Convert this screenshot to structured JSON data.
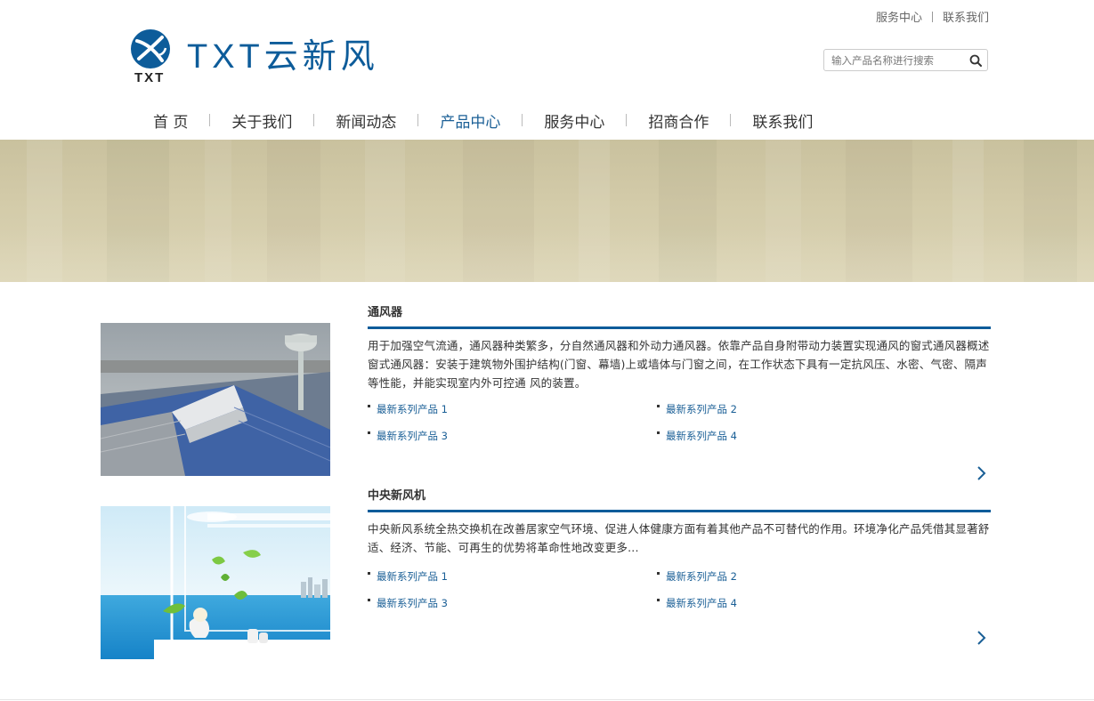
{
  "top_links": {
    "service": "服务中心",
    "contact": "联系我们"
  },
  "logo": {
    "mark_text": "TXT",
    "text": "TXT云新风",
    "brand_color": "#0d5c9a"
  },
  "search": {
    "placeholder": "输入产品名称进行搜索",
    "value": "",
    "icon": "search-icon"
  },
  "nav": {
    "items": [
      "首 页",
      "关于我们",
      "新闻动态",
      "产品中心",
      "服务中心",
      "招商合作",
      "联系我们"
    ],
    "active": "产品中心",
    "active_color": "#1a5f96"
  },
  "products": [
    {
      "title": "通风器",
      "description": "用于加强空气流通，通风器种类繁多，分自然通风器和外动力通风器。依靠产品自身附带动力装置实现通风的窗式通风器概述窗式通风器：安装于建筑物外围护结构(门窗、幕墙)上或墙体与门窗之间，在工作状态下具有一定抗风压、水密、气密、隔声等性能，并能实现室内外可控通 风的装置。",
      "links": [
        "最新系列产品 1",
        "最新系列产品 2",
        "最新系列产品 3",
        "最新系列产品 4"
      ],
      "image": "rooftop-ventilator-photo",
      "more_icon": "chevron-right-icon"
    },
    {
      "title": "中央新风机",
      "description": "中央新风系统全热交换机在改善居家空气环境、促进人体健康方面有着其他产品不可替代的作用。环境净化产品凭借其显著舒适、经济、节能、可再生的优势将革命性地改变更多...",
      "links": [
        "最新系列产品 1",
        "最新系列产品 2",
        "最新系列产品 3",
        "最新系列产品 4"
      ],
      "image": "fresh-air-seaside-photo",
      "more_icon": "chevron-right-icon"
    }
  ]
}
